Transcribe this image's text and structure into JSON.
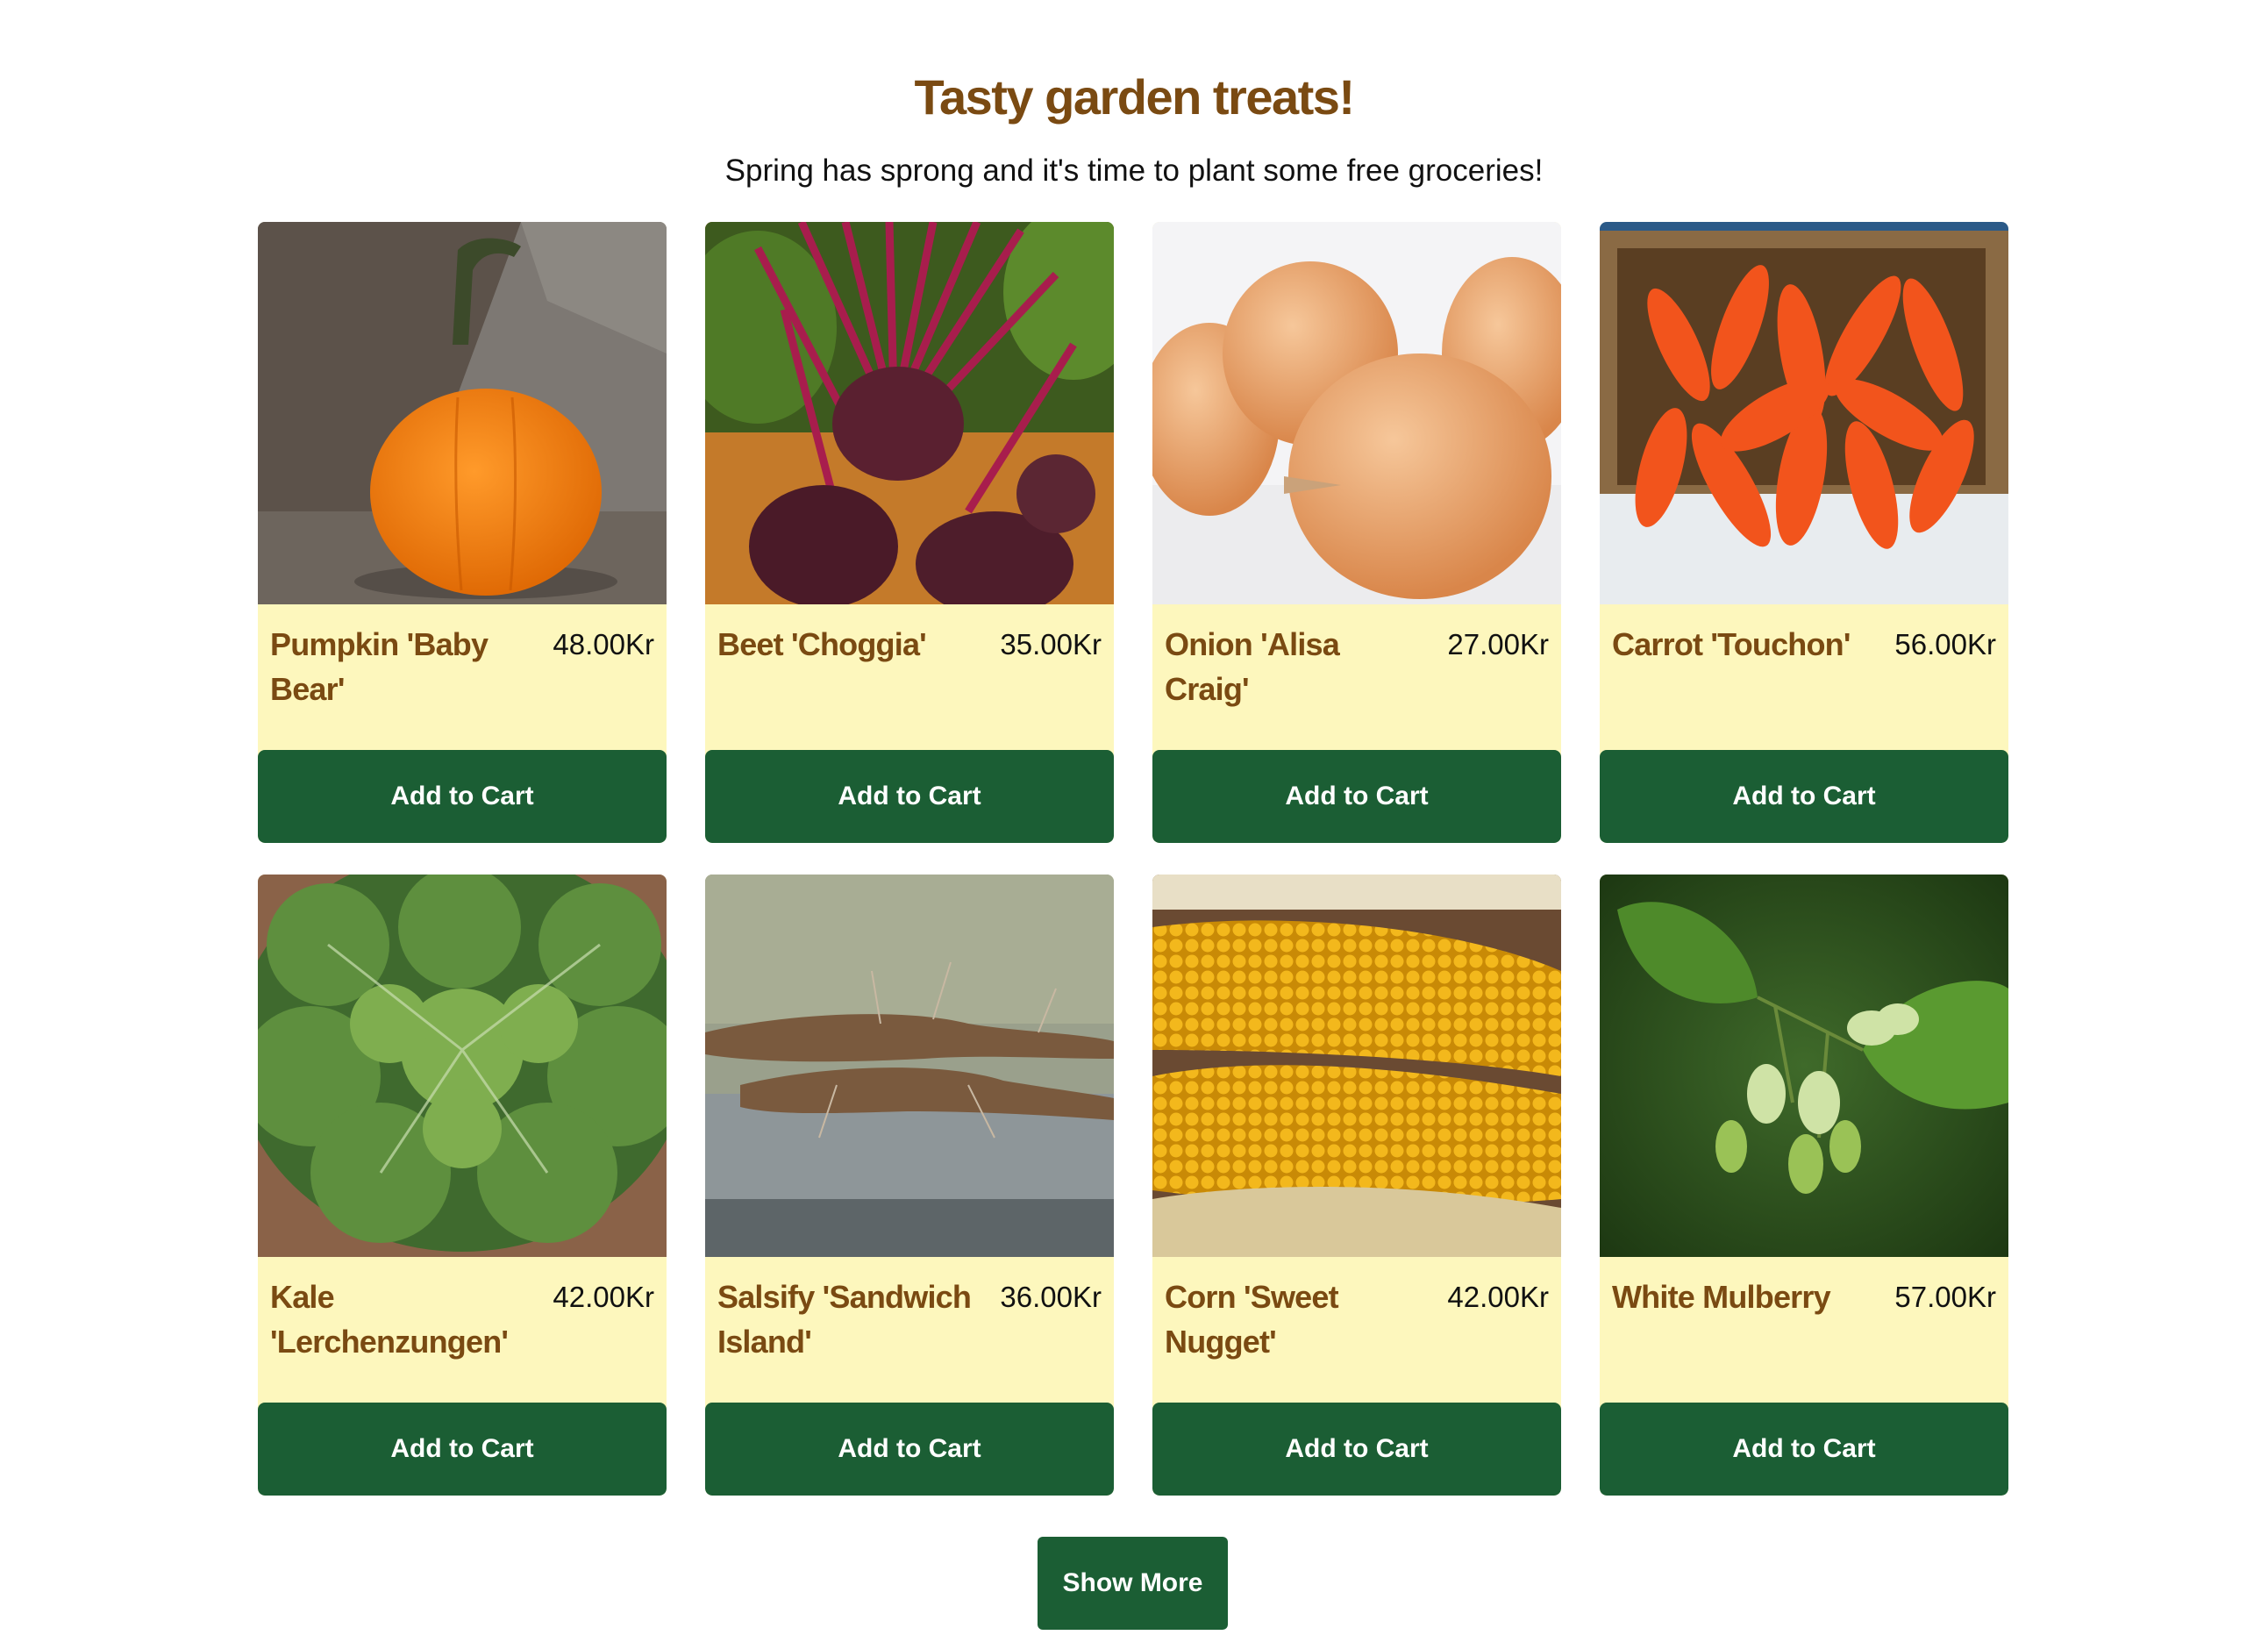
{
  "header": {
    "title": "Tasty garden treats!",
    "subtitle": "Spring has sprong and it's time to plant some free groceries!"
  },
  "products": [
    {
      "name": "Pumpkin 'Baby Bear'",
      "price": "48.00Kr",
      "button": "Add to Cart"
    },
    {
      "name": "Beet 'Choggia'",
      "price": "35.00Kr",
      "button": "Add to Cart"
    },
    {
      "name": "Onion 'Alisa Craig'",
      "price": "27.00Kr",
      "button": "Add to Cart"
    },
    {
      "name": "Carrot 'Touchon'",
      "price": "56.00Kr",
      "button": "Add to Cart"
    },
    {
      "name": "Kale 'Lerchenzungen'",
      "price": "42.00Kr",
      "button": "Add to Cart"
    },
    {
      "name": "Salsify 'Sandwich Island'",
      "price": "36.00Kr",
      "button": "Add to Cart"
    },
    {
      "name": "Corn 'Sweet Nugget'",
      "price": "42.00Kr",
      "button": "Add to Cart"
    },
    {
      "name": "White Mulberry",
      "price": "57.00Kr",
      "button": "Add to Cart"
    }
  ],
  "show_more_label": "Show More",
  "colors": {
    "title": "#7a4a12",
    "card_background": "#fdf7bd",
    "button": "#1b5e34",
    "button_text": "#ffffff"
  }
}
